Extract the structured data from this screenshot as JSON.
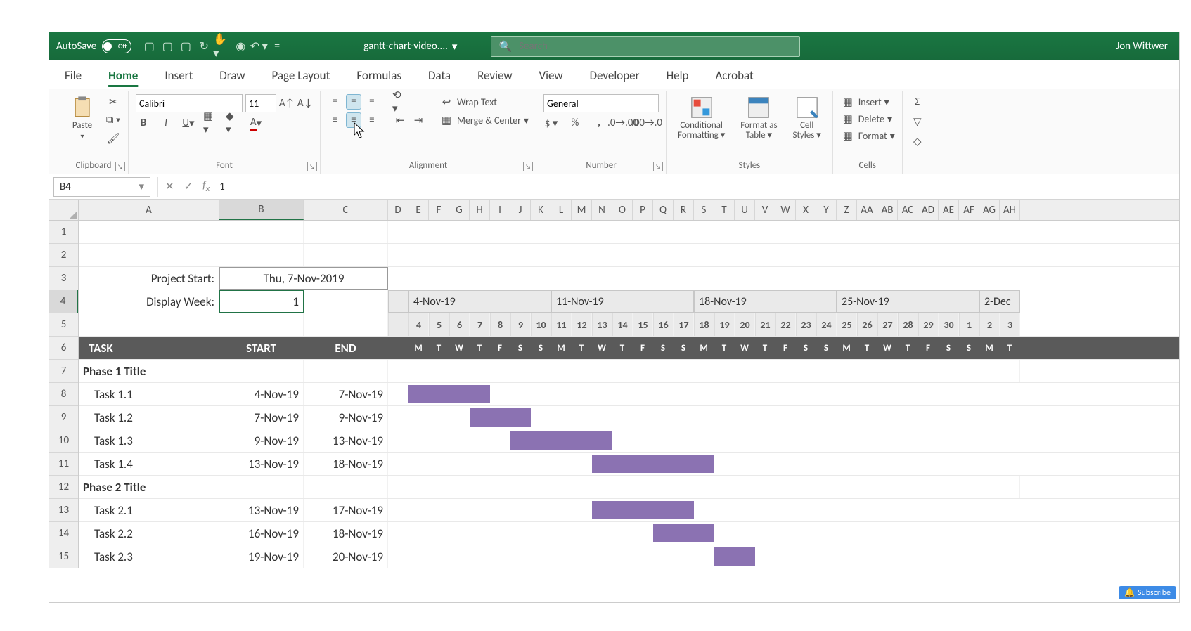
{
  "titlebar": {
    "autosave_label": "AutoSave",
    "autosave_state": "Off",
    "document_name": "gantt-chart-video....",
    "search_placeholder": "Search",
    "user_name": "Jon Wittwer"
  },
  "ribbon_tabs": [
    "File",
    "Home",
    "Insert",
    "Draw",
    "Page Layout",
    "Formulas",
    "Data",
    "Review",
    "View",
    "Developer",
    "Help",
    "Acrobat"
  ],
  "active_tab": "Home",
  "ribbon": {
    "clipboard": {
      "paste": "Paste",
      "label": "Clipboard"
    },
    "font": {
      "name": "Calibri",
      "size": "11",
      "label": "Font"
    },
    "alignment": {
      "wrap": "Wrap Text",
      "merge": "Merge & Center",
      "label": "Alignment"
    },
    "number": {
      "format": "General",
      "label": "Number"
    },
    "styles": {
      "cond": "Conditional Formatting",
      "table": "Format as Table",
      "cell": "Cell Styles",
      "label": "Styles"
    },
    "cells": {
      "insert": "Insert",
      "delete": "Delete",
      "format": "Format",
      "label": "Cells"
    }
  },
  "formula_bar": {
    "name_box": "B4",
    "value": "1"
  },
  "columns": {
    "letters": [
      "A",
      "B",
      "C",
      "D",
      "E",
      "F",
      "G",
      "H",
      "I",
      "J",
      "K",
      "L",
      "M",
      "N",
      "O",
      "P",
      "Q",
      "R",
      "S",
      "T",
      "U",
      "V",
      "W",
      "X",
      "Y",
      "Z",
      "AA",
      "AB",
      "AC",
      "AD",
      "AE",
      "AF",
      "AG",
      "AH"
    ],
    "widths": [
      200,
      120,
      120,
      29,
      29,
      29,
      29,
      29,
      29,
      29,
      29,
      29,
      29,
      29,
      29,
      29,
      29,
      29,
      29,
      29,
      29,
      29,
      29,
      29,
      29,
      29,
      29,
      29,
      29,
      29,
      29,
      29,
      29,
      29
    ]
  },
  "gantt": {
    "project_start_label": "Project Start:",
    "project_start": "Thu, 7-Nov-2019",
    "display_week_label": "Display Week:",
    "display_week": "1",
    "week_headers": [
      "4-Nov-19",
      "11-Nov-19",
      "18-Nov-19",
      "25-Nov-19",
      "2-Dec"
    ],
    "day_numbers": [
      "4",
      "5",
      "6",
      "7",
      "8",
      "9",
      "10",
      "11",
      "12",
      "13",
      "14",
      "15",
      "16",
      "17",
      "18",
      "19",
      "20",
      "21",
      "22",
      "23",
      "24",
      "25",
      "26",
      "27",
      "28",
      "29",
      "30",
      "1",
      "2",
      "3"
    ],
    "task_header": {
      "task": "TASK",
      "start": "START",
      "end": "END"
    },
    "dow": [
      "M",
      "T",
      "W",
      "T",
      "F",
      "S",
      "S",
      "M",
      "T",
      "W",
      "T",
      "F",
      "S",
      "S",
      "M",
      "T",
      "W",
      "T",
      "F",
      "S",
      "S",
      "M",
      "T",
      "W",
      "T",
      "F",
      "S",
      "S",
      "M",
      "T"
    ],
    "rows": [
      {
        "r": 7,
        "type": "phase",
        "task": "Phase 1 Title"
      },
      {
        "r": 8,
        "type": "task",
        "task": "Task 1.1",
        "start": "4-Nov-19",
        "end": "7-Nov-19",
        "bar_from": 0,
        "bar_to": 4
      },
      {
        "r": 9,
        "type": "task",
        "task": "Task 1.2",
        "start": "7-Nov-19",
        "end": "9-Nov-19",
        "bar_from": 3,
        "bar_to": 6
      },
      {
        "r": 10,
        "type": "task",
        "task": "Task 1.3",
        "start": "9-Nov-19",
        "end": "13-Nov-19",
        "bar_from": 5,
        "bar_to": 10
      },
      {
        "r": 11,
        "type": "task",
        "task": "Task 1.4",
        "start": "13-Nov-19",
        "end": "18-Nov-19",
        "bar_from": 9,
        "bar_to": 15
      },
      {
        "r": 12,
        "type": "phase",
        "task": "Phase 2 Title"
      },
      {
        "r": 13,
        "type": "task",
        "task": "Task 2.1",
        "start": "13-Nov-19",
        "end": "17-Nov-19",
        "bar_from": 9,
        "bar_to": 14
      },
      {
        "r": 14,
        "type": "task",
        "task": "Task 2.2",
        "start": "16-Nov-19",
        "end": "18-Nov-19",
        "bar_from": 12,
        "bar_to": 15
      },
      {
        "r": 15,
        "type": "task",
        "task": "Task 2.3",
        "start": "19-Nov-19",
        "end": "20-Nov-19",
        "bar_from": 15,
        "bar_to": 17
      }
    ]
  },
  "subscribe": "Subscribe"
}
